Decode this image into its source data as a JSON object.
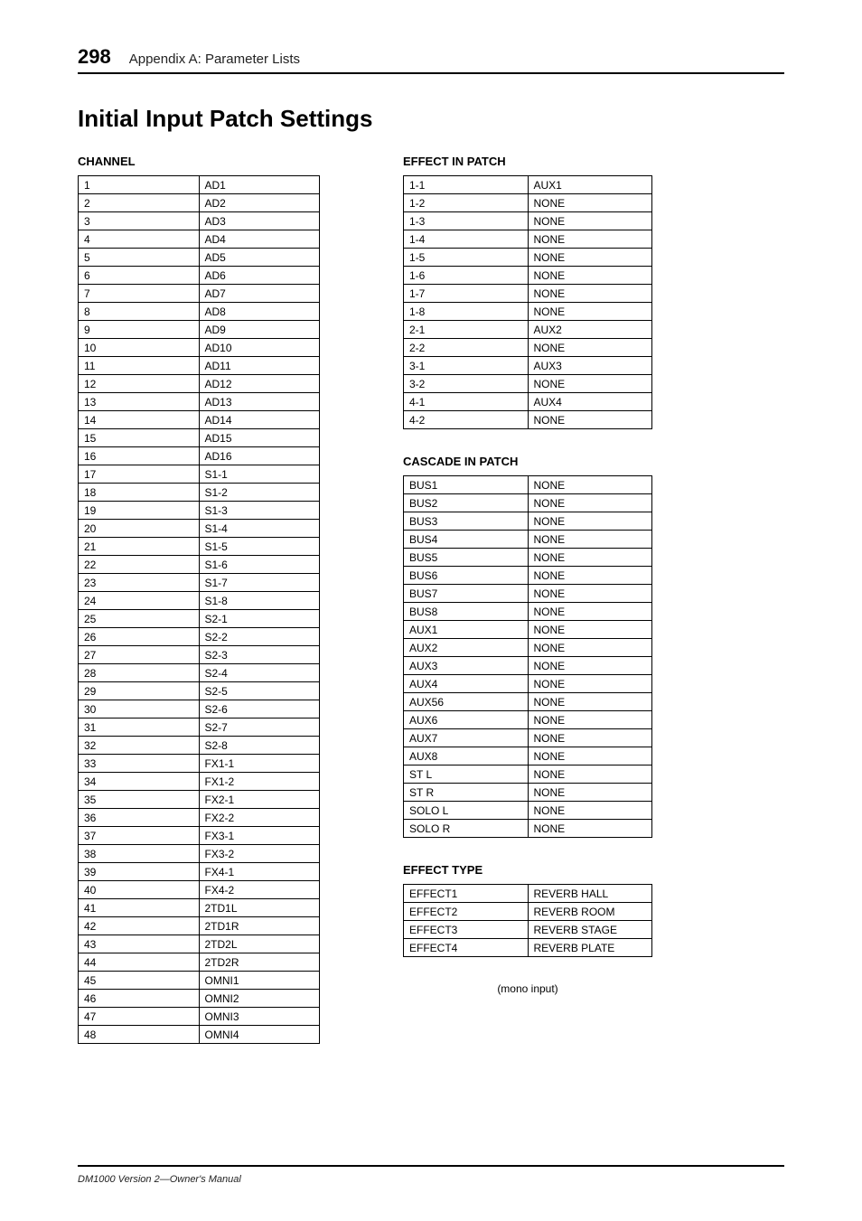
{
  "header": {
    "page_number": "298",
    "chapter": "Appendix A: Parameter Lists"
  },
  "section_title": "Initial Input Patch Settings",
  "channel": {
    "title": "CHANNEL",
    "rows": [
      {
        "k": "1",
        "v": "AD1"
      },
      {
        "k": "2",
        "v": "AD2"
      },
      {
        "k": "3",
        "v": "AD3"
      },
      {
        "k": "4",
        "v": "AD4"
      },
      {
        "k": "5",
        "v": "AD5"
      },
      {
        "k": "6",
        "v": "AD6"
      },
      {
        "k": "7",
        "v": "AD7"
      },
      {
        "k": "8",
        "v": "AD8"
      },
      {
        "k": "9",
        "v": "AD9"
      },
      {
        "k": "10",
        "v": "AD10"
      },
      {
        "k": "11",
        "v": "AD11"
      },
      {
        "k": "12",
        "v": "AD12"
      },
      {
        "k": "13",
        "v": "AD13"
      },
      {
        "k": "14",
        "v": "AD14"
      },
      {
        "k": "15",
        "v": "AD15"
      },
      {
        "k": "16",
        "v": "AD16"
      },
      {
        "k": "17",
        "v": "S1-1"
      },
      {
        "k": "18",
        "v": "S1-2"
      },
      {
        "k": "19",
        "v": "S1-3"
      },
      {
        "k": "20",
        "v": "S1-4"
      },
      {
        "k": "21",
        "v": "S1-5"
      },
      {
        "k": "22",
        "v": "S1-6"
      },
      {
        "k": "23",
        "v": "S1-7"
      },
      {
        "k": "24",
        "v": "S1-8"
      },
      {
        "k": "25",
        "v": "S2-1"
      },
      {
        "k": "26",
        "v": "S2-2"
      },
      {
        "k": "27",
        "v": "S2-3"
      },
      {
        "k": "28",
        "v": "S2-4"
      },
      {
        "k": "29",
        "v": "S2-5"
      },
      {
        "k": "30",
        "v": "S2-6"
      },
      {
        "k": "31",
        "v": "S2-7"
      },
      {
        "k": "32",
        "v": "S2-8"
      },
      {
        "k": "33",
        "v": "FX1-1"
      },
      {
        "k": "34",
        "v": "FX1-2"
      },
      {
        "k": "35",
        "v": "FX2-1"
      },
      {
        "k": "36",
        "v": "FX2-2"
      },
      {
        "k": "37",
        "v": "FX3-1"
      },
      {
        "k": "38",
        "v": "FX3-2"
      },
      {
        "k": "39",
        "v": "FX4-1"
      },
      {
        "k": "40",
        "v": "FX4-2"
      },
      {
        "k": "41",
        "v": "2TD1L"
      },
      {
        "k": "42",
        "v": "2TD1R"
      },
      {
        "k": "43",
        "v": "2TD2L"
      },
      {
        "k": "44",
        "v": "2TD2R"
      },
      {
        "k": "45",
        "v": "OMNI1"
      },
      {
        "k": "46",
        "v": "OMNI2"
      },
      {
        "k": "47",
        "v": "OMNI3"
      },
      {
        "k": "48",
        "v": "OMNI4"
      }
    ]
  },
  "effect_in_patch": {
    "title": "EFFECT IN PATCH",
    "rows": [
      {
        "k": "1-1",
        "v": "AUX1"
      },
      {
        "k": "1-2",
        "v": "NONE"
      },
      {
        "k": "1-3",
        "v": "NONE"
      },
      {
        "k": "1-4",
        "v": "NONE"
      },
      {
        "k": "1-5",
        "v": "NONE"
      },
      {
        "k": "1-6",
        "v": "NONE"
      },
      {
        "k": "1-7",
        "v": "NONE"
      },
      {
        "k": "1-8",
        "v": "NONE"
      },
      {
        "k": "2-1",
        "v": "AUX2"
      },
      {
        "k": "2-2",
        "v": "NONE"
      },
      {
        "k": "3-1",
        "v": "AUX3"
      },
      {
        "k": "3-2",
        "v": "NONE"
      },
      {
        "k": "4-1",
        "v": "AUX4"
      },
      {
        "k": "4-2",
        "v": "NONE"
      }
    ]
  },
  "cascade_in_patch": {
    "title": "CASCADE IN PATCH",
    "rows": [
      {
        "k": "BUS1",
        "v": "NONE"
      },
      {
        "k": "BUS2",
        "v": "NONE"
      },
      {
        "k": "BUS3",
        "v": "NONE"
      },
      {
        "k": "BUS4",
        "v": "NONE"
      },
      {
        "k": "BUS5",
        "v": "NONE"
      },
      {
        "k": "BUS6",
        "v": "NONE"
      },
      {
        "k": "BUS7",
        "v": "NONE"
      },
      {
        "k": "BUS8",
        "v": "NONE"
      },
      {
        "k": "AUX1",
        "v": "NONE"
      },
      {
        "k": "AUX2",
        "v": "NONE"
      },
      {
        "k": "AUX3",
        "v": "NONE"
      },
      {
        "k": "AUX4",
        "v": "NONE"
      },
      {
        "k": "AUX56",
        "v": "NONE"
      },
      {
        "k": "AUX6",
        "v": "NONE"
      },
      {
        "k": "AUX7",
        "v": "NONE"
      },
      {
        "k": "AUX8",
        "v": "NONE"
      },
      {
        "k": "ST L",
        "v": "NONE"
      },
      {
        "k": "ST R",
        "v": "NONE"
      },
      {
        "k": "SOLO L",
        "v": "NONE"
      },
      {
        "k": "SOLO R",
        "v": "NONE"
      }
    ]
  },
  "effect_type": {
    "title": "EFFECT TYPE",
    "rows": [
      {
        "k": "EFFECT1",
        "v": "REVERB HALL"
      },
      {
        "k": "EFFECT2",
        "v": "REVERB ROOM"
      },
      {
        "k": "EFFECT3",
        "v": "REVERB STAGE"
      },
      {
        "k": "EFFECT4",
        "v": "REVERB PLATE"
      }
    ]
  },
  "mono_note": "(mono input)",
  "footer": "DM1000 Version 2—Owner's Manual"
}
